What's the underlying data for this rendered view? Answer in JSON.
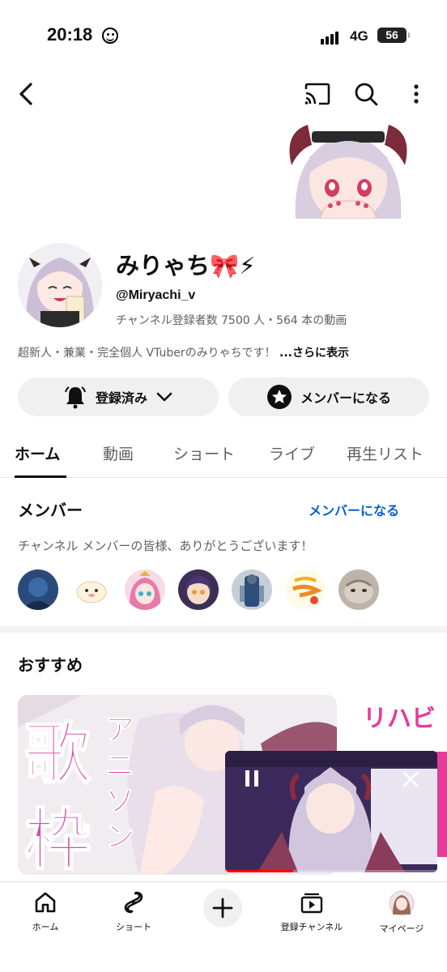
{
  "status_bar": {
    "time": "20:18",
    "network": "4G",
    "battery": "56"
  },
  "channel": {
    "name": "みりゃち🎀⚡",
    "handle": "@Miryachi_v",
    "stats": "チャンネル登録者数 7500 人・564 本の動画",
    "description": "超新人・兼業・完全個人 VTuberのみりゃちです！",
    "more": "...さらに表示"
  },
  "actions": {
    "subscribed": "登録済み",
    "join": "メンバーになる"
  },
  "tabs": [
    "ホーム",
    "動画",
    "ショート",
    "ライブ",
    "再生リスト"
  ],
  "members": {
    "title": "メンバー",
    "link": "メンバーになる",
    "thanks": "チャンネル メンバーの皆様、ありがとうございます！"
  },
  "recommended": {
    "title": "おすすめ"
  },
  "thumbnail1": {
    "text_main_1": "歌",
    "text_main_2": "枠",
    "text_side": "アニソン"
  },
  "thumbnail2": {
    "text": "リハビ"
  },
  "bottom_nav": [
    "ホーム",
    "ショート",
    "登録チャンネル",
    "マイページ"
  ],
  "colors": {
    "accent_link": "#065fd4",
    "progress": "#ff0000",
    "thumb_text": "#d94aa8"
  }
}
